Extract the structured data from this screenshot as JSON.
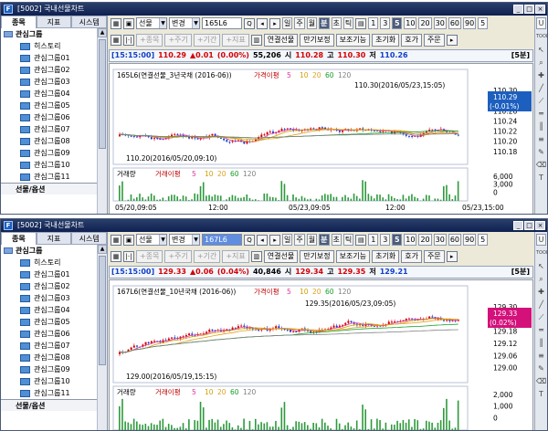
{
  "windows": [
    {
      "title": "[5002] 국내선물차트",
      "sidebar": {
        "tabs": [
          "종목",
          "지표",
          "시스템"
        ],
        "group_header": "관심그룹",
        "items": [
          "히스토리",
          "관심그룹01",
          "관심그룹02",
          "관심그룹03",
          "관심그룹04",
          "관심그룹05",
          "관심그룹06",
          "관심그룹07",
          "관심그룹08",
          "관심그룹09",
          "관심그룹10",
          "관심그룹11"
        ],
        "footer": "선물/옵션"
      },
      "toolbar": {
        "market_select": "선물",
        "change_select": "변경",
        "code": "165L6",
        "periods": [
          "일",
          "주",
          "월",
          "분",
          "초",
          "틱"
        ],
        "intervals": [
          "1",
          "3",
          "5",
          "10",
          "20",
          "30",
          "60",
          "90",
          "5"
        ],
        "active_period": "분",
        "active_interval": "5"
      },
      "toolbar2": {
        "disabled": [
          "종목",
          "주기",
          "기간",
          "지표"
        ],
        "actions": [
          "연결선물",
          "만기보정",
          "보조기능",
          "초기화",
          "호가",
          "주문"
        ]
      },
      "price_line": {
        "time": "[15:15:00]",
        "price": "110.29",
        "change": "▲0.01",
        "pct": "(0.00%)",
        "volume": "55,206",
        "open_label": "시",
        "open": "110.28",
        "high_label": "고",
        "high": "110.30",
        "low_label": "저",
        "low": "110.26",
        "interval": "[5분]"
      },
      "chart": {
        "legend_name": "165L6(연결선물_3년국채 (2016-06))",
        "legend_ma": "가격이평",
        "legend_ma_periods": [
          "5",
          "10",
          "20",
          "60",
          "120"
        ],
        "high_annotation": "110.30(2016/05/23,15:05)",
        "low_annotation": "110.20(2016/05/20,09:10)",
        "price_tag": "110.29",
        "price_tag_change": "(-0.01%)",
        "price_ticks": [
          "110.30",
          "110.28",
          "110.26",
          "110.24",
          "110.22",
          "110.20",
          "110.18"
        ],
        "volume_legend": "거래량",
        "volume_ma": "거래이평",
        "volume_ma_periods": [
          "5",
          "10",
          "20",
          "60",
          "120"
        ],
        "volume_ticks": [
          "6,000",
          "3,000",
          "0"
        ],
        "time_labels": [
          "05/20,09:05",
          "12:00",
          "05/23,09:05",
          "12:00",
          "05/23,15:00"
        ]
      }
    },
    {
      "title": "[5002] 국내선물차트",
      "sidebar": {
        "tabs": [
          "종목",
          "지표",
          "시스템"
        ],
        "group_header": "관심그룹",
        "items": [
          "히스토리",
          "관심그룹01",
          "관심그룹02",
          "관심그룹03",
          "관심그룹04",
          "관심그룹05",
          "관심그룹06",
          "관심그룹07",
          "관심그룹08",
          "관심그룹09",
          "관심그룹10",
          "관심그룹11"
        ],
        "footer": "선물/옵션"
      },
      "toolbar": {
        "market_select": "선물",
        "change_select": "변경",
        "code": "167L6",
        "periods": [
          "일",
          "주",
          "월",
          "분",
          "초",
          "틱"
        ],
        "intervals": [
          "1",
          "3",
          "5",
          "10",
          "20",
          "30",
          "60",
          "90",
          "5"
        ],
        "active_period": "분",
        "active_interval": "5"
      },
      "toolbar2": {
        "disabled": [
          "종목",
          "주기",
          "기간",
          "지표"
        ],
        "actions": [
          "연결선물",
          "만기보정",
          "보조기능",
          "초기화",
          "호가",
          "주문"
        ]
      },
      "price_line": {
        "time": "[15:15:00]",
        "price": "129.33",
        "change": "▲0.06",
        "pct": "(0.04%)",
        "volume": "40,846",
        "open_label": "시",
        "open": "129.34",
        "high_label": "고",
        "high": "129.35",
        "low_label": "저",
        "low": "129.21",
        "interval": "[5분]"
      },
      "chart": {
        "legend_name": "167L6(연결선물_10년국채 (2016-06))",
        "legend_ma": "가격이평",
        "legend_ma_periods": [
          "5",
          "10",
          "20",
          "60",
          "120"
        ],
        "high_annotation": "129.35(2016/05/23,09:05)",
        "low_annotation": "129.00(2016/05/19,15:15)",
        "price_tag": "129.33",
        "price_tag_change": "(0.02%)",
        "price_ticks": [
          "129.30",
          "129.24",
          "129.18",
          "129.12",
          "129.06",
          "129.00"
        ],
        "volume_legend": "거래량",
        "volume_ma": "거래이평",
        "volume_ma_periods": [
          "5",
          "10",
          "20",
          "60",
          "120"
        ],
        "volume_ticks": [
          "2,000",
          "1,000",
          "0"
        ],
        "time_labels": []
      }
    }
  ],
  "right_toolbar_icons": [
    "u-button",
    "tool-label",
    "cursor-icon",
    "zoom-icon",
    "cross-icon",
    "line-icon",
    "trend-icon",
    "hline-icon",
    "vline-icon",
    "fibo-icon",
    "text-icon",
    "pen-icon",
    "erase-icon",
    "text-t-icon"
  ],
  "right_toolbar_u": "U",
  "right_toolbar_tool": "TOOL",
  "right_toolbar_t": "T",
  "colors": {
    "title_bar": "#0e2050",
    "price_up": "#d40000",
    "price_tag": "#1d5fbf",
    "price_tag_2": "#d4107a",
    "candle_up": "#d40000",
    "candle_down": "#1140c8",
    "ma5": "#e0349c",
    "ma10": "#d0a000",
    "ma20": "#e0a020",
    "ma60": "#18a028",
    "ma120": "#808080"
  }
}
